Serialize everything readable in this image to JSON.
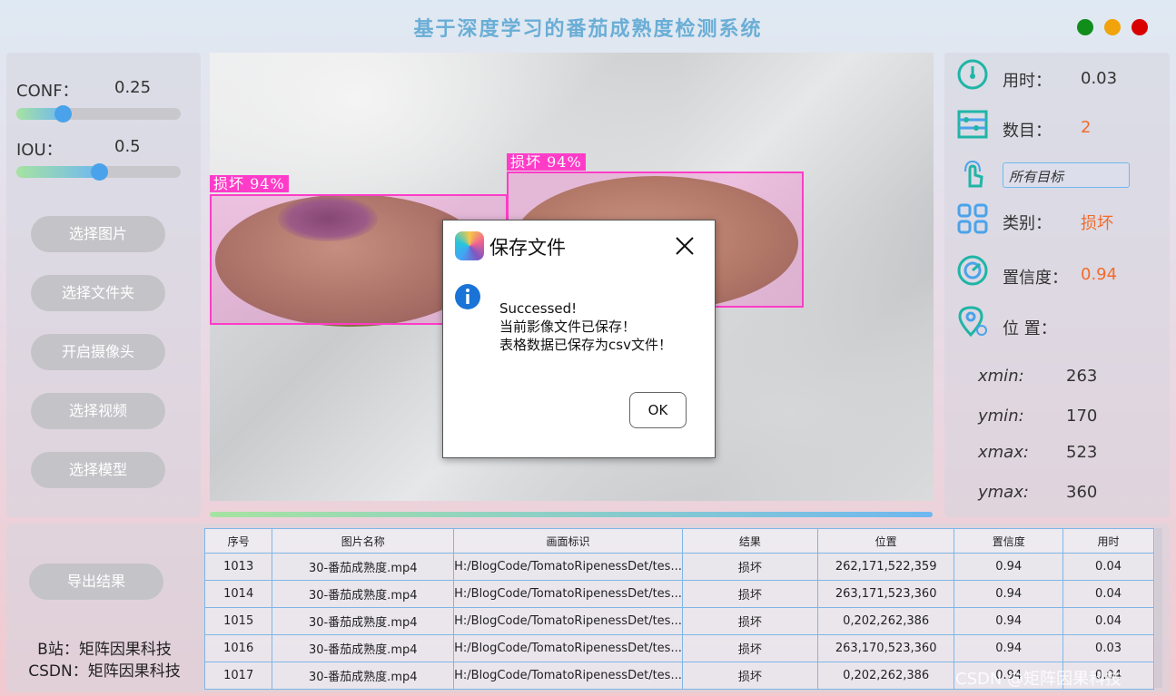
{
  "app": {
    "title": "基于深度学习的番茄成熟度检测系统",
    "window_dots": [
      "#118d1c",
      "#f0a30a",
      "#d90000"
    ]
  },
  "left": {
    "conf_label": "CONF：",
    "conf_value": "0.25",
    "conf_level": 0.25,
    "iou_label": "IOU：",
    "iou_value": "0.5",
    "iou_level": 0.5,
    "buttons": [
      "选择图片",
      "选择文件夹",
      "开启摄像头",
      "选择视频",
      "选择模型"
    ],
    "export_label": "导出结果",
    "credits": [
      "B站：矩阵因果科技",
      "CSDN：矩阵因果科技"
    ]
  },
  "detections": [
    {
      "tag": "损坏 94%"
    },
    {
      "tag": "损坏 94%"
    }
  ],
  "right": {
    "time_label": "用时：",
    "time_value": "0.03",
    "count_label": "数目：",
    "count_value": "2",
    "target_select": "所有目标",
    "class_label": "类别：",
    "class_value": "损坏",
    "conf_label": "置信度：",
    "conf_value": "0.94",
    "pos_label": "位 置：",
    "coords": [
      {
        "label": "xmin:",
        "value": "263"
      },
      {
        "label": "ymin:",
        "value": "170"
      },
      {
        "label": "xmax:",
        "value": "523"
      },
      {
        "label": "ymax:",
        "value": "360"
      }
    ],
    "accent": "#f26b2a"
  },
  "table": {
    "headers": [
      "序号",
      "图片名称",
      "画面标识",
      "结果",
      "位置",
      "置信度",
      "用时"
    ],
    "rows": [
      [
        "1013",
        "30-番茄成熟度.mp4",
        "H:/BlogCode/TomatoRipenessDet/tes...",
        "损坏",
        "262,171,522,359",
        "0.94",
        "0.04"
      ],
      [
        "1014",
        "30-番茄成熟度.mp4",
        "H:/BlogCode/TomatoRipenessDet/tes...",
        "损坏",
        "263,171,523,360",
        "0.94",
        "0.04"
      ],
      [
        "1015",
        "30-番茄成熟度.mp4",
        "H:/BlogCode/TomatoRipenessDet/tes...",
        "损坏",
        "0,202,262,386",
        "0.94",
        "0.04"
      ],
      [
        "1016",
        "30-番茄成熟度.mp4",
        "H:/BlogCode/TomatoRipenessDet/tes...",
        "损坏",
        "263,170,523,360",
        "0.94",
        "0.03"
      ],
      [
        "1017",
        "30-番茄成熟度.mp4",
        "H:/BlogCode/TomatoRipenessDet/tes...",
        "损坏",
        "0,202,262,386",
        "0.94",
        "0.04"
      ]
    ]
  },
  "dialog": {
    "title": "保存文件",
    "line1": "Successed!",
    "line2": "当前影像文件已保存！",
    "line3": "表格数据已保存为csv文件！",
    "ok_label": "OK",
    "info_icon": "info-icon",
    "close_icon": "close-icon"
  },
  "watermark": "CSDN @矩阵因果科技"
}
